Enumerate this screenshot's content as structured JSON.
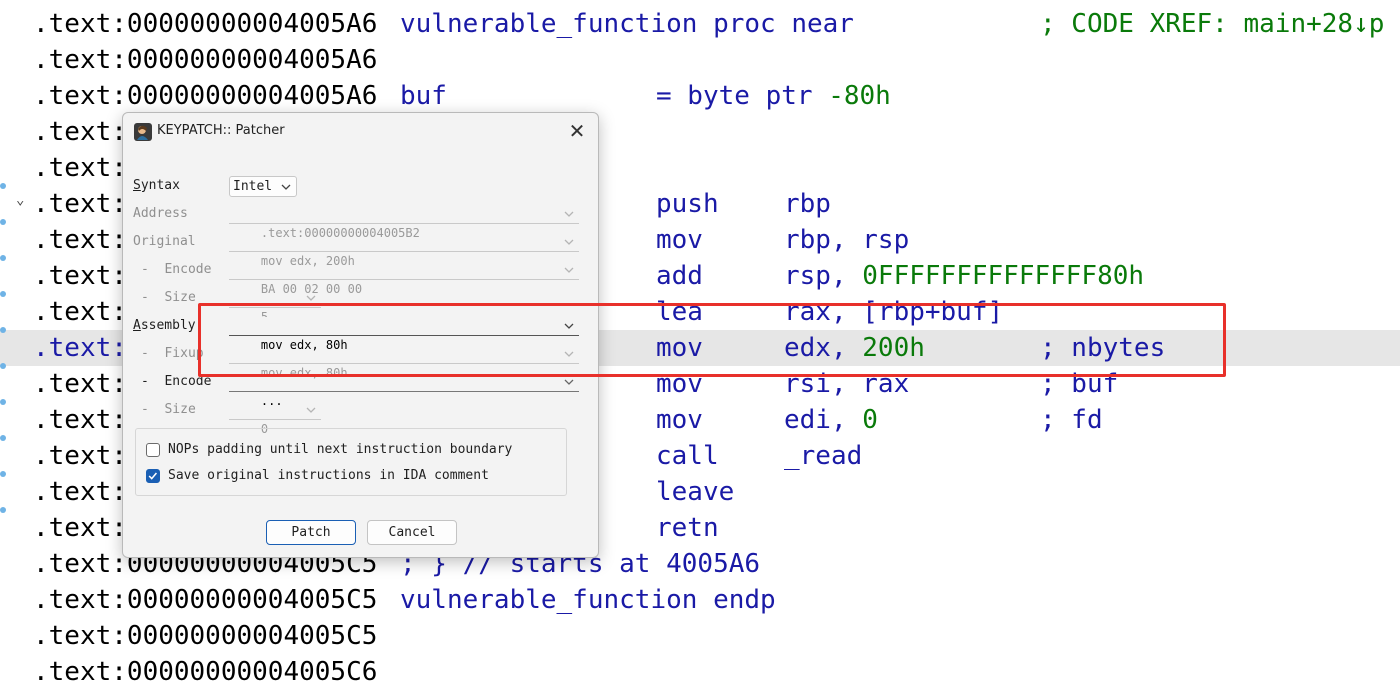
{
  "listing": {
    "lines": [
      {
        "prefix": ".text:00000000004005A6",
        "c1": "vulnerable_function proc near",
        "c4": "; CODE XREF: main+28↓p"
      },
      {
        "prefix": ".text:00000000004005A6"
      },
      {
        "prefix": ".text:00000000004005A6",
        "c1": "buf",
        "c2": "= byte ptr",
        "c2num": "-80h"
      },
      {
        "prefix": ".text:"
      },
      {
        "prefix": ".text:"
      },
      {
        "prefix": ".text:",
        "c2": "push",
        "c3": "rbp"
      },
      {
        "prefix": ".text:",
        "c2": "mov",
        "c3": "rbp, rsp"
      },
      {
        "prefix": ".text:",
        "c2": "add",
        "c3": "rsp,",
        "c3num": "0FFFFFFFFFFFFFF80h"
      },
      {
        "prefix": ".text:",
        "c2": "lea",
        "c3": "rax, [rbp+buf]"
      },
      {
        "prefix": ".text:",
        "c2": "mov",
        "c3": "edx,",
        "c3num": "200h",
        "c4": "; nbytes"
      },
      {
        "prefix": ".text:",
        "c2": "mov",
        "c3": "rsi, rax",
        "c4": "; buf"
      },
      {
        "prefix": ".text:",
        "c2": "mov",
        "c3": "edi,",
        "c3num": "0",
        "c4": "; fd"
      },
      {
        "prefix": ".text:",
        "c2": "call",
        "c3": "_read"
      },
      {
        "prefix": ".text:",
        "c2": "leave"
      },
      {
        "prefix": ".text:",
        "c2": "retn"
      },
      {
        "prefix": ".text:00000000004005C5",
        "c1": "; } // starts at 4005A6"
      },
      {
        "prefix": ".text:00000000004005C5",
        "c1": "vulnerable_function endp"
      },
      {
        "prefix": ".text:00000000004005C5"
      },
      {
        "prefix": ".text:00000000004005C6"
      }
    ]
  },
  "dialog": {
    "title": "KEYPATCH:: Patcher",
    "close_glyph": "✕",
    "syntax_label": "Syntax",
    "syntax_value": "Intel",
    "address_label": "Address",
    "address_value": ".text:00000000004005B2",
    "original_label": "Original",
    "original_value": "mov edx, 200h",
    "orig_encode_label": "-  Encode",
    "orig_encode_value": "BA 00 02 00 00",
    "orig_size_label": "-  Size",
    "orig_size_value": "5",
    "assembly_label": "Assembly",
    "assembly_value": "mov edx, 80h",
    "fixup_label": "-  Fixup",
    "fixup_value": "mov edx, 80h",
    "new_encode_label": "-  Encode",
    "new_encode_value": "...",
    "new_size_label": "-  Size",
    "new_size_value": "0",
    "nops_label": "NOPs padding until next instruction boundary",
    "save_label": "Save original instructions in IDA comment",
    "nops_checked": false,
    "save_checked": true,
    "patch_label": "Patch",
    "cancel_label": "Cancel"
  },
  "colors": {
    "keyword": "#1a1aa6",
    "number": "#0a7a0a",
    "highlight": "#e6e6e6",
    "annotation": "#e8302a",
    "accent": "#1a5fb4"
  }
}
